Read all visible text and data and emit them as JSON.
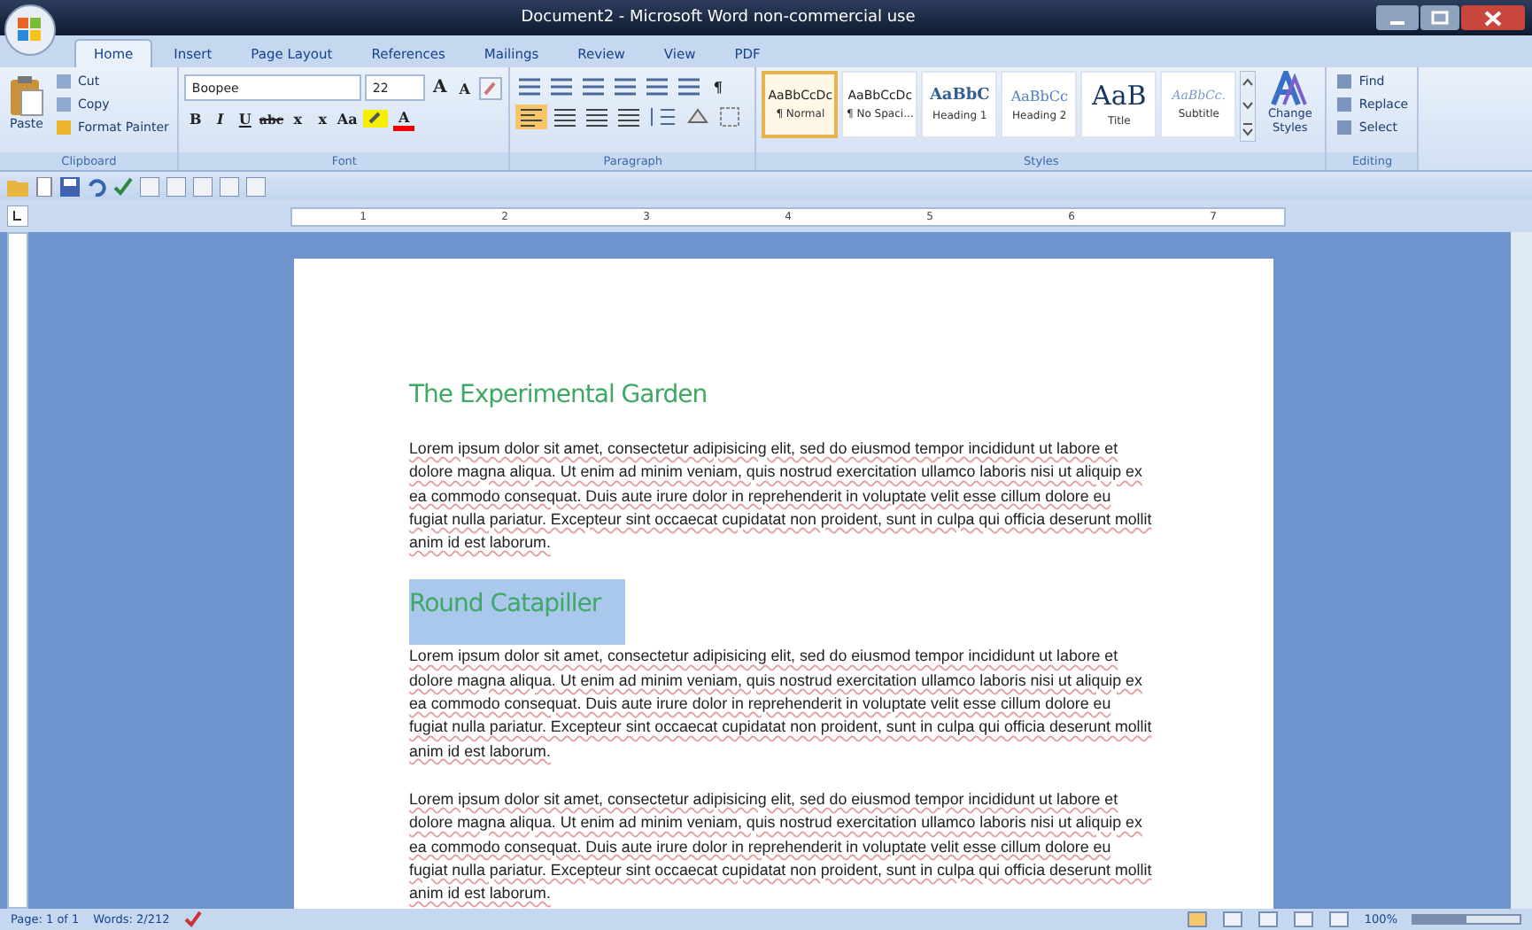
{
  "window": {
    "title": "Document2 - Microsoft Word non-commercial use"
  },
  "tabs": [
    {
      "label": "Home",
      "selected": true
    },
    {
      "label": "Insert",
      "selected": false
    },
    {
      "label": "Page Layout",
      "selected": false
    },
    {
      "label": "References",
      "selected": false
    },
    {
      "label": "Mailings",
      "selected": false
    },
    {
      "label": "Review",
      "selected": false
    },
    {
      "label": "View",
      "selected": false
    },
    {
      "label": "PDF",
      "selected": false
    }
  ],
  "ribbon": {
    "clipboard": {
      "label": "Clipboard",
      "paste": "Paste",
      "items": [
        "Cut",
        "Copy",
        "Format Painter"
      ]
    },
    "font": {
      "label": "Font",
      "name": "Boopee",
      "size": "22",
      "grow": "A",
      "shrink": "A",
      "buttons": [
        "B",
        "I",
        "U",
        "abc",
        "x",
        "x",
        "Aa"
      ],
      "font_color": "A"
    },
    "paragraph": {
      "label": "Paragraph",
      "pilcrow": "¶"
    },
    "styles": {
      "label": "Styles",
      "change": "Change Styles",
      "items": [
        {
          "kind": "normal",
          "sample": "AaBbCcDc",
          "name": "¶ Normal",
          "selected": true
        },
        {
          "kind": "nospacing",
          "sample": "AaBbCcDc",
          "name": "¶ No Spaci...",
          "selected": false
        },
        {
          "kind": "heading1",
          "sample": "AaBbC",
          "name": "Heading 1",
          "selected": false
        },
        {
          "kind": "heading2",
          "sample": "AaBbCc",
          "name": "Heading 2",
          "selected": false
        },
        {
          "kind": "title",
          "sample": "AaB",
          "name": "Title",
          "selected": false
        },
        {
          "kind": "subtitle",
          "sample": "AaBbCc.",
          "name": "Subtitle",
          "selected": false
        }
      ]
    },
    "editing": {
      "label": "Editing",
      "items": [
        "Find",
        "Replace",
        "Select"
      ]
    }
  },
  "ruler": [
    "1",
    "2",
    "3",
    "4",
    "5",
    "6",
    "7"
  ],
  "document": {
    "blocks": [
      {
        "kind": "heading",
        "text": "The Experimental Garden",
        "selected": false
      },
      {
        "kind": "paragraph",
        "text": "Lorem ipsum dolor sit amet, consectetur adipisicing elit, sed do eiusmod tempor incididunt ut labore et dolore magna aliqua. Ut enim ad minim veniam, quis nostrud exercitation ullamco laboris nisi ut aliquip ex ea commodo consequat. Duis aute irure dolor in reprehenderit in voluptate velit esse cillum dolore eu fugiat nulla pariatur. Excepteur sint occaecat cupidatat non proident, sunt in culpa qui officia deserunt mollit anim id est laborum."
      },
      {
        "kind": "heading",
        "text": "Round Catapiller",
        "selected": true
      },
      {
        "kind": "paragraph",
        "text": "Lorem ipsum dolor sit amet, consectetur adipisicing elit, sed do eiusmod tempor incididunt ut labore et dolore magna aliqua. Ut enim ad minim veniam, quis nostrud exercitation ullamco laboris nisi ut aliquip ex ea commodo consequat. Duis aute irure dolor in reprehenderit in voluptate velit esse cillum dolore eu fugiat nulla pariatur. Excepteur sint occaecat cupidatat non proident, sunt in culpa qui officia deserunt mollit anim id est laborum."
      },
      {
        "kind": "paragraph",
        "text": "Lorem ipsum dolor sit amet, consectetur adipisicing elit, sed do eiusmod tempor incididunt ut labore et dolore magna aliqua. Ut enim ad minim veniam, quis nostrud exercitation ullamco laboris nisi ut aliquip ex ea commodo consequat. Duis aute irure dolor in reprehenderit in voluptate velit esse cillum dolore eu fugiat nulla pariatur. Excepteur sint occaecat cupidatat non proident, sunt in culpa qui officia deserunt mollit anim id est laborum."
      }
    ]
  },
  "status_bar": {
    "page": "Page: 1 of 1",
    "words": "Words: 2/212",
    "zoom": "100%",
    "zoom_slider": {
      "level": 0.5
    }
  }
}
